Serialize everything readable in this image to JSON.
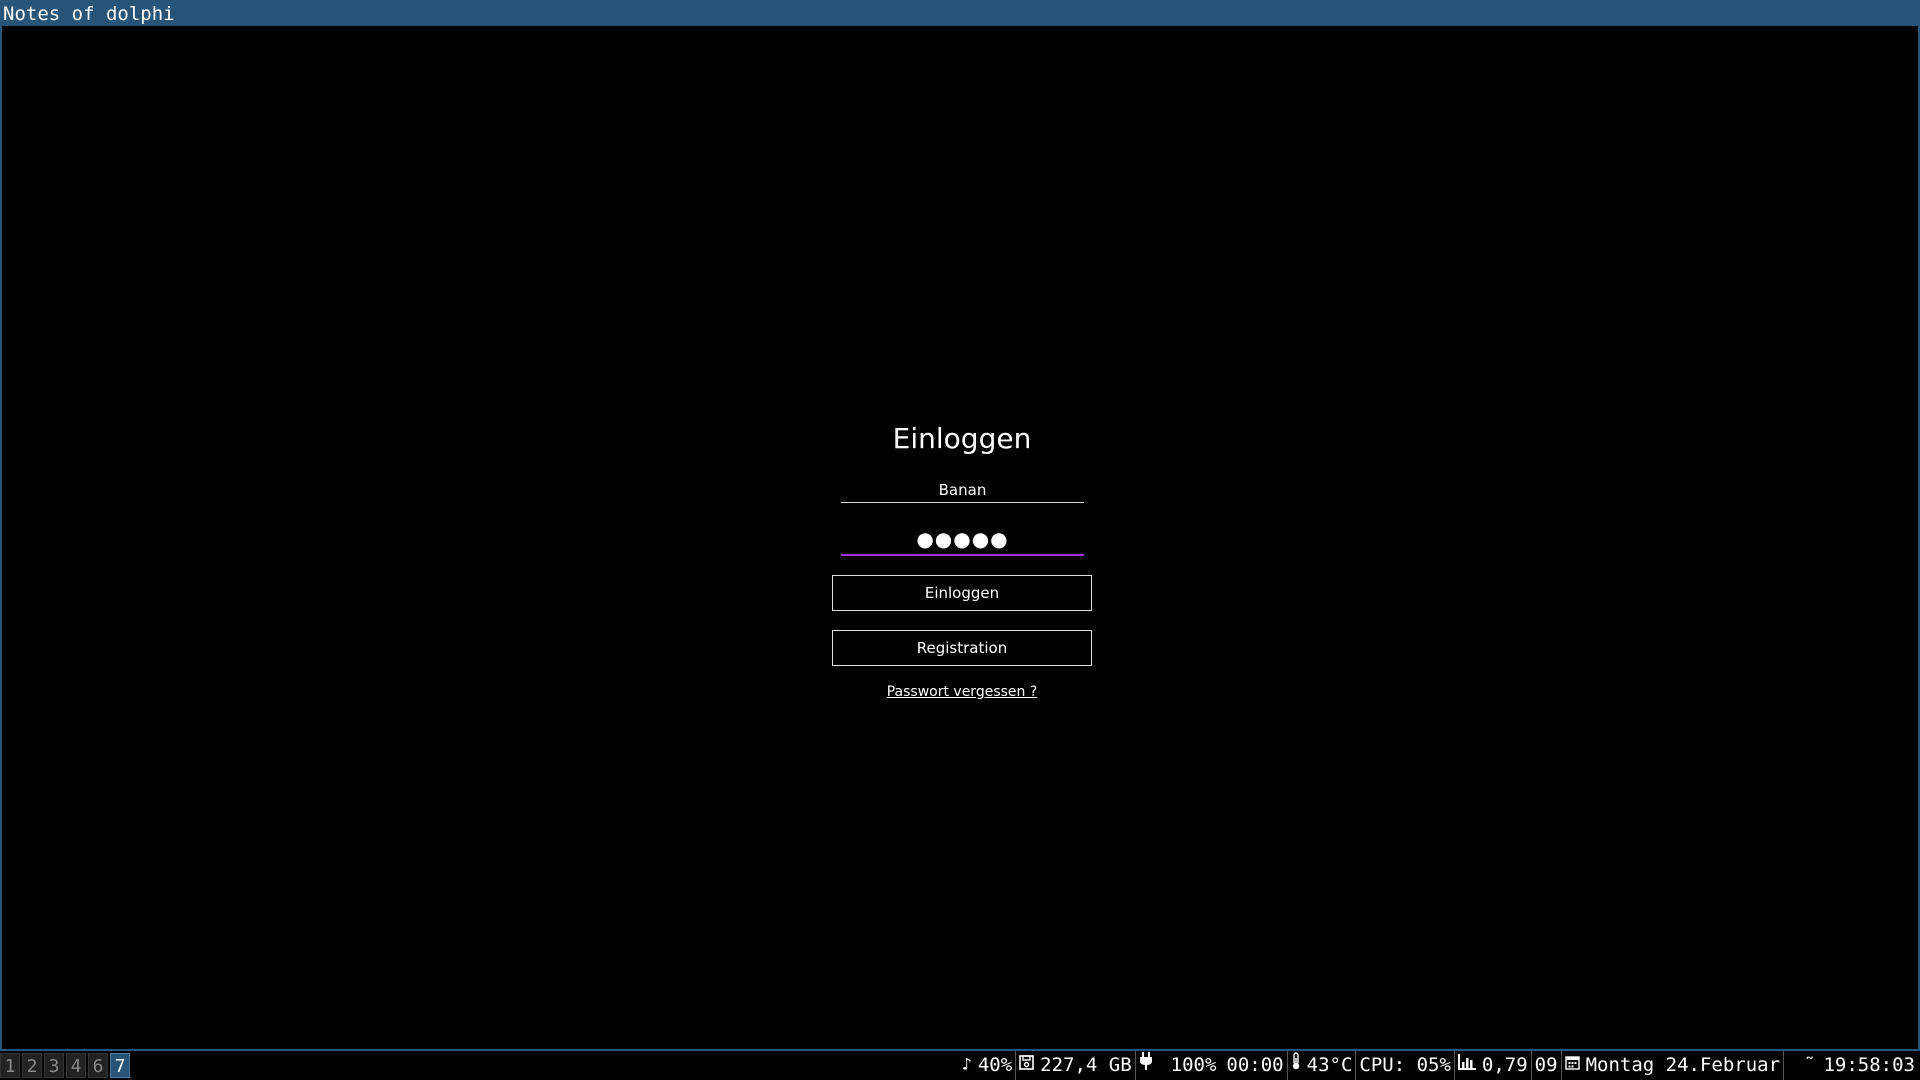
{
  "window": {
    "title": "Notes of dolphi",
    "accent_color": "#285577"
  },
  "login": {
    "title": "Einloggen",
    "username_value": "Banan",
    "password_value": "●●●●●",
    "login_button": "Einloggen",
    "register_button": "Registration",
    "forgot_link": "Passwort vergessen ?",
    "focus_color": "#9b30e0"
  },
  "bar": {
    "workspaces": [
      {
        "label": "1",
        "focused": false
      },
      {
        "label": "2",
        "focused": false
      },
      {
        "label": "3",
        "focused": false
      },
      {
        "label": "4",
        "focused": false
      },
      {
        "label": "6",
        "focused": false
      },
      {
        "label": "7",
        "focused": true
      }
    ],
    "volume_icon": "♪",
    "volume": "40%",
    "disk_icon": "disk-icon",
    "disk": "227,4 GB",
    "power_icon": "plug-icon",
    "battery": "100%",
    "battery_time": "00:00",
    "temp_icon": "thermometer-icon",
    "temperature": "43°C",
    "cpu": "CPU: 05%",
    "load_icon": "chart-icon",
    "load": "0,79",
    "week": "09",
    "calendar_icon": "calendar-icon",
    "date": "Montag 24.Februar",
    "time_prefix": "˜",
    "time": "19:58:03"
  }
}
